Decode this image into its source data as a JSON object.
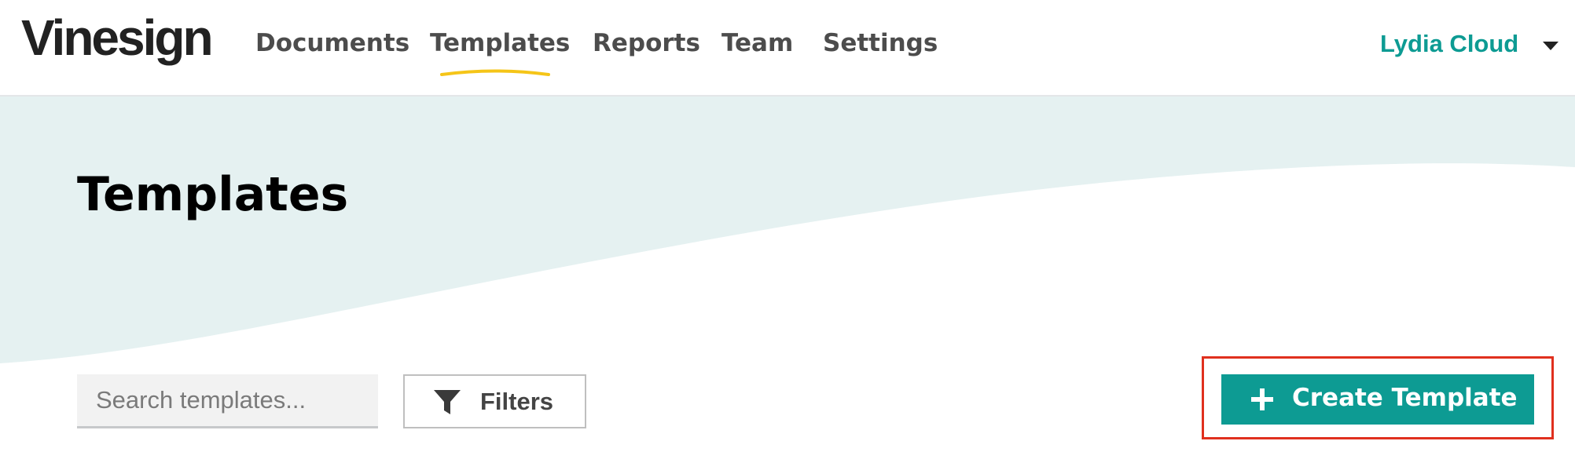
{
  "brand": {
    "logo_text": "Vinesign"
  },
  "nav": {
    "items": [
      {
        "label": "Documents"
      },
      {
        "label": "Templates",
        "active": true
      },
      {
        "label": "Reports"
      },
      {
        "label": "Team"
      },
      {
        "label": "Settings"
      }
    ],
    "active_underline_color": "#f5c518"
  },
  "user": {
    "name": "Lydia Cloud",
    "dropdown_icon": "caret-down-icon"
  },
  "page": {
    "title": "Templates"
  },
  "toolbar": {
    "search_placeholder": "Search templates...",
    "search_value": "",
    "filters_label": "Filters",
    "filters_icon": "filter-icon",
    "create_label": "Create Template",
    "create_icon": "plus-icon"
  },
  "colors": {
    "accent": "#0d9b93",
    "hero_bg": "#e5f1f1",
    "highlight": "#e0301e",
    "nav_text": "#4c4c4c"
  }
}
